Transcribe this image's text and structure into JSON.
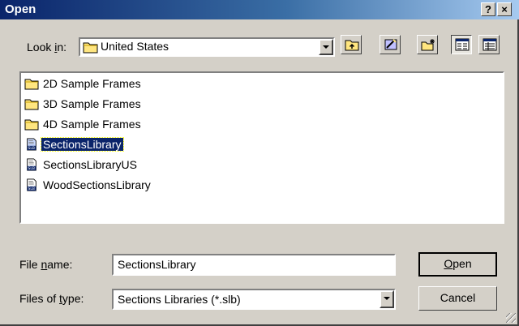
{
  "window": {
    "title": "Open",
    "help_label": "?",
    "close_label": "×"
  },
  "look_in": {
    "label_pre": "Look ",
    "label_key": "i",
    "label_post": "n:",
    "value": "United States"
  },
  "toolbar": {
    "icons": [
      "up-one-level-icon",
      "desktop-icon",
      "new-folder-icon",
      "list-view-icon",
      "details-view-icon"
    ]
  },
  "files": [
    {
      "name": "2D Sample Frames",
      "type": "folder"
    },
    {
      "name": "3D Sample Frames",
      "type": "folder"
    },
    {
      "name": "4D Sample Frames",
      "type": "folder"
    },
    {
      "name": "SectionsLibrary",
      "type": "slb",
      "selected": true
    },
    {
      "name": "SectionsLibraryUS",
      "type": "slb"
    },
    {
      "name": "WoodSectionsLibrary",
      "type": "slb"
    }
  ],
  "file_name": {
    "label_pre": "File ",
    "label_key": "n",
    "label_post": "ame:",
    "value": "SectionsLibrary"
  },
  "file_type": {
    "label_pre": "Files of ",
    "label_key": "t",
    "label_post": "ype:",
    "value": "Sections Libraries (*.slb)"
  },
  "buttons": {
    "open_key": "O",
    "open_rest": "pen",
    "cancel": "Cancel"
  },
  "colors": {
    "title_start": "#0a246a",
    "title_end": "#a6caf0",
    "face": "#d4d0c8",
    "selection": "#0a246a"
  }
}
